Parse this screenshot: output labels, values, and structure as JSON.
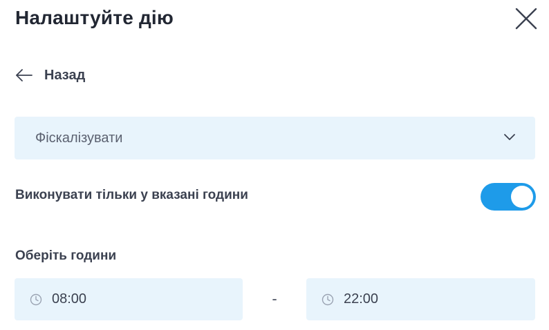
{
  "dialog": {
    "title": "Налаштуйте дію"
  },
  "back": {
    "label": "Назад"
  },
  "action_select": {
    "value": "Фіскалізувати"
  },
  "schedule": {
    "toggle_label": "Виконувати тільки у вказані години",
    "toggle_on": true,
    "hours_label": "Оберіть години",
    "from": "08:00",
    "separator": "-",
    "to": "22:00"
  },
  "colors": {
    "accent": "#1e9be9",
    "field_background": "#e8f4fc",
    "text": "#3b4150"
  },
  "icons": {
    "close": "close-icon",
    "back": "arrow-left-icon",
    "dropdown": "chevron-down-icon",
    "time": "clock-icon"
  }
}
